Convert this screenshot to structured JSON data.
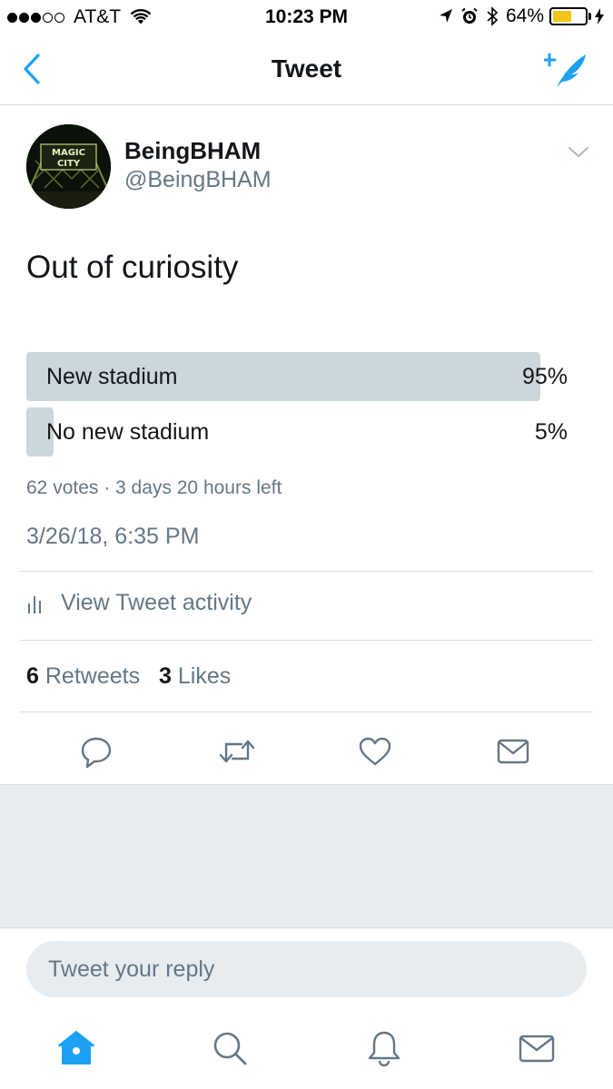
{
  "status_bar": {
    "carrier": "AT&T",
    "time": "10:23 PM",
    "battery_percent": "64%",
    "battery_level": 0.64,
    "signal_bars": 3,
    "signal_total": 5,
    "icons": [
      "wifi-icon",
      "location-icon",
      "alarm-icon",
      "bluetooth-icon",
      "battery-icon",
      "charging-icon"
    ]
  },
  "nav": {
    "title": "Tweet",
    "back_icon": "chevron-left-icon",
    "compose_icon": "compose-tweet-icon"
  },
  "tweet": {
    "display_name": "BeingBHAM",
    "handle": "@BeingBHAM",
    "text": "Out of curiosity",
    "avatar_text": "MAGIC CITY",
    "timestamp": "3/26/18, 6:35 PM"
  },
  "poll": {
    "options": [
      {
        "label": "New stadium",
        "percent": "95%",
        "fraction": 0.95
      },
      {
        "label": "No new stadium",
        "percent": "5%",
        "fraction": 0.05
      }
    ],
    "meta": "62 votes · 3 days 20 hours left"
  },
  "activity": {
    "label": "View Tweet activity",
    "icon": "bar-chart-icon"
  },
  "stats": {
    "retweets_count": "6",
    "retweets_label": "Retweets",
    "likes_count": "3",
    "likes_label": "Likes"
  },
  "actions": [
    "reply-icon",
    "retweet-icon",
    "like-icon",
    "direct-message-icon"
  ],
  "reply": {
    "placeholder": "Tweet your reply"
  },
  "tabs": [
    "home-icon",
    "search-icon",
    "notifications-icon",
    "messages-icon"
  ],
  "colors": {
    "accent": "#1da1f2",
    "secondary_text": "#657786",
    "poll_bar": "#ccd6dd",
    "background_gray": "#e6ecf0",
    "battery_fill": "#f5c518"
  }
}
